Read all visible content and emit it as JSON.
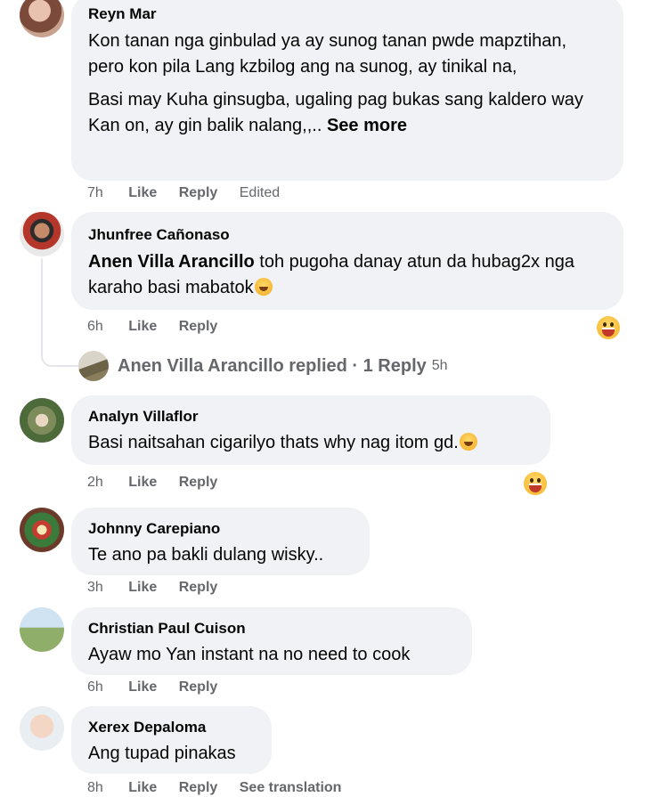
{
  "comments": [
    {
      "author": "Reyn Mar",
      "paragraph1": "Kon tanan nga ginbulad ya ay sunog tanan pwde mapztihan, pero kon pila Lang kzbilog ang na sunog, ay tinikal na,",
      "paragraph2": "Basi may Kuha ginsugba, ugaling pag bukas sang kaldero way Kan on, ay gin balik nalang,,..",
      "see_more": "See more",
      "time": "7h",
      "like": "Like",
      "reply": "Reply",
      "edited": "Edited"
    },
    {
      "author": "Jhunfree Cañonaso",
      "mention": "Anen Villa Arancillo",
      "text": "toh pugoha danay atun da hubag2x nga karaho basi mabatok",
      "time": "6h",
      "like": "Like",
      "reply": "Reply",
      "reaction_icon": "laughing-face-icon"
    },
    {
      "author": "Analyn Villaflor",
      "text": "Basi naitsahan cigarilyo thats why nag itom gd.",
      "time": "2h",
      "like": "Like",
      "reply": "Reply",
      "reaction_icon": "laughing-face-icon"
    },
    {
      "author": "Johnny Carepiano",
      "text": "Te ano pa bakli dulang wisky..",
      "time": "3h",
      "like": "Like",
      "reply": "Reply"
    },
    {
      "author": "Christian Paul Cuison",
      "text": "Ayaw mo Yan instant na no need to cook",
      "time": "6h",
      "like": "Like",
      "reply": "Reply"
    },
    {
      "author": "Xerex Depaloma",
      "text": "Ang tupad pinakas",
      "time": "8h",
      "like": "Like",
      "reply": "Reply",
      "translate": "See translation"
    }
  ],
  "replied": {
    "text": "Anen Villa Arancillo replied · 1 Reply",
    "time": "5h"
  },
  "colors": {
    "bubble": "#f0f2f5",
    "meta": "#65676b",
    "text": "#050505"
  }
}
